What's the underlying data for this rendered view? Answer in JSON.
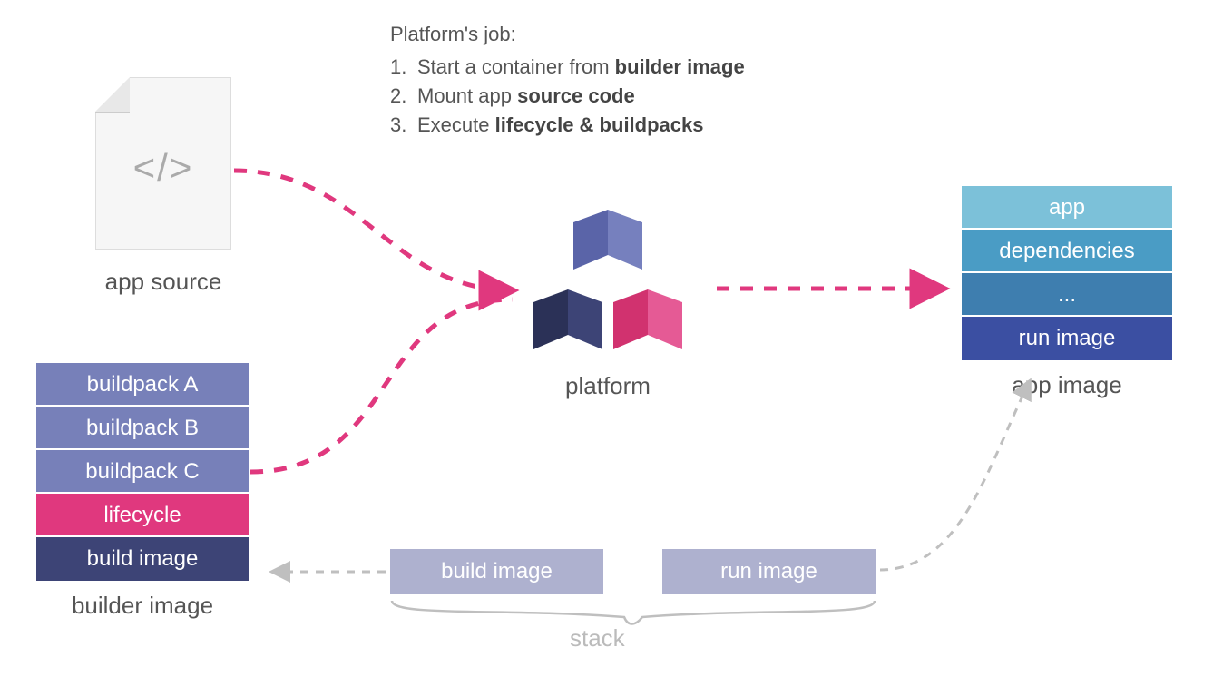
{
  "job": {
    "title": "Platform's job:",
    "steps": [
      {
        "num": "1.",
        "pre": "Start a container from ",
        "bold": "builder image"
      },
      {
        "num": "2.",
        "pre": "Mount app ",
        "bold": "source code"
      },
      {
        "num": "3.",
        "pre": "Execute ",
        "bold": "lifecycle & buildpacks"
      }
    ]
  },
  "app_source": {
    "glyph": "</>",
    "label": "app source"
  },
  "builder_image": {
    "layers": [
      {
        "label": "buildpack A",
        "class": "bp"
      },
      {
        "label": "buildpack B",
        "class": "bp"
      },
      {
        "label": "buildpack C",
        "class": "bp"
      },
      {
        "label": "lifecycle",
        "class": "lc"
      },
      {
        "label": "build image",
        "class": "bi"
      }
    ],
    "label": "builder image"
  },
  "platform": {
    "label": "platform"
  },
  "app_image": {
    "layers": [
      {
        "label": "app",
        "class": "al-app"
      },
      {
        "label": "dependencies",
        "class": "al-dep"
      },
      {
        "label": "...",
        "class": "al-etc"
      },
      {
        "label": "run image",
        "class": "al-run"
      }
    ],
    "label": "app image"
  },
  "stack": {
    "build": "build image",
    "run": "run image",
    "label": "stack"
  },
  "colors": {
    "arrow_pink": "#e0387e",
    "arrow_gray": "#bfbfbf"
  }
}
